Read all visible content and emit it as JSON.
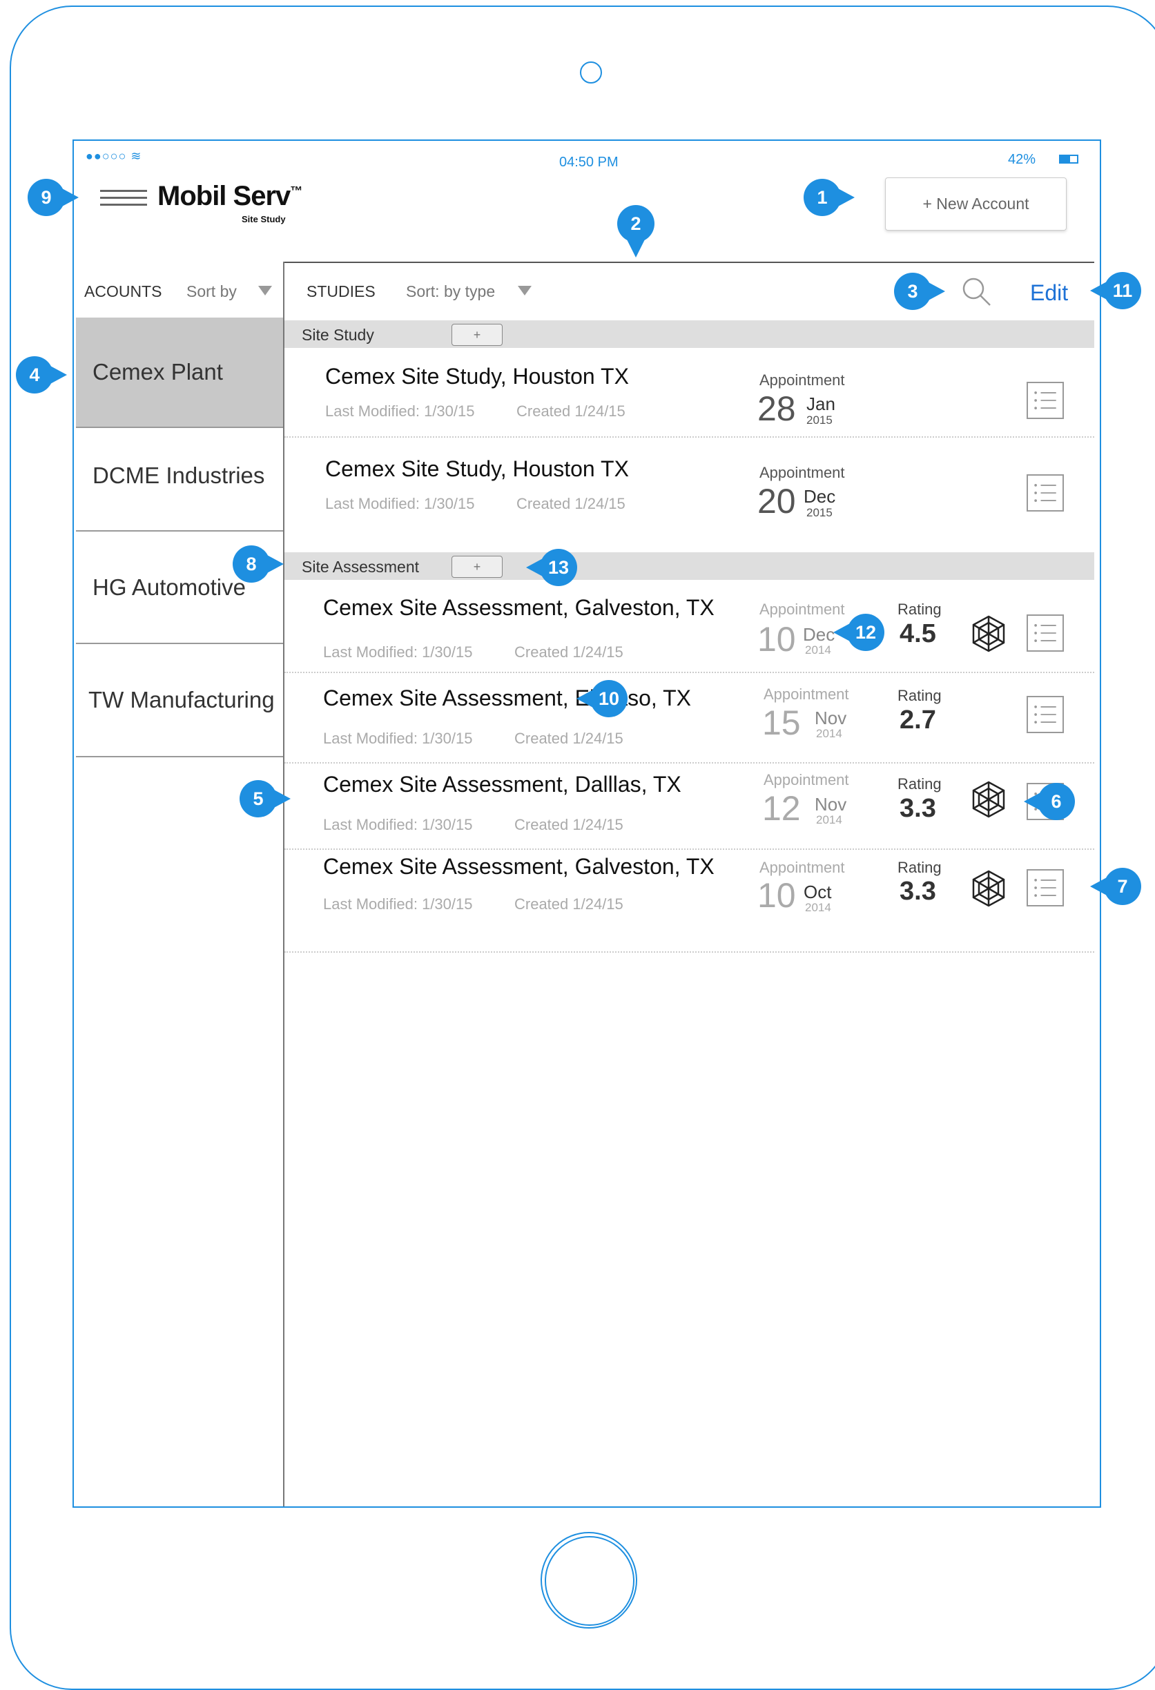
{
  "status_bar": {
    "time": "04:50 PM",
    "battery": "42%"
  },
  "header": {
    "logo": "Mobil Serv",
    "logo_tm": "™",
    "logo_sub": "Site Study",
    "new_account_label": "+   New Account"
  },
  "accounts_pane": {
    "title": "ACOUNTS",
    "sort_label": "Sort by",
    "items": [
      {
        "label": "Cemex Plant",
        "selected": true
      },
      {
        "label": "DCME Industries"
      },
      {
        "label": "HG Automotive"
      },
      {
        "label": "TW Manufacturing"
      }
    ]
  },
  "studies_pane": {
    "title": "STUDIES",
    "sort_label": "Sort: by type",
    "edit_label": "Edit",
    "sections": [
      {
        "label": "Site Study",
        "add_label": "+",
        "rows": [
          {
            "title": "Cemex Site Study, Houston TX",
            "modified": "Last Modified: 1/30/15",
            "created": "Created 1/24/15",
            "appt_label": "Appointment",
            "day": "28",
            "month": "Jan",
            "year": "2015"
          },
          {
            "title": "Cemex Site Study, Houston TX",
            "modified": "Last Modified: 1/30/15",
            "created": "Created 1/24/15",
            "appt_label": "Appointment",
            "day": "20",
            "month": "Dec",
            "year": "2015"
          }
        ]
      },
      {
        "label": "Site Assessment",
        "add_label": "+",
        "rows": [
          {
            "title": "Cemex Site Assessment, Galveston, TX",
            "modified": "Last Modified: 1/30/15",
            "created": "Created 1/24/15",
            "appt_label": "Appointment",
            "day": "10",
            "month": "Dec",
            "year": "2014",
            "rating_label": "Rating",
            "rating": "4.5",
            "radar": true
          },
          {
            "title": "Cemex Site Assessment, El Paso, TX",
            "modified": "Last Modified: 1/30/15",
            "created": "Created 1/24/15",
            "appt_label": "Appointment",
            "day": "15",
            "month": "Nov",
            "year": "2014",
            "rating_label": "Rating",
            "rating": "2.7",
            "radar": false
          },
          {
            "title": "Cemex Site Assessment, Dalllas, TX",
            "modified": "Last Modified: 1/30/15",
            "created": "Created 1/24/15",
            "appt_label": "Appointment",
            "day": "12",
            "month": "Nov",
            "year": "2014",
            "rating_label": "Rating",
            "rating": "3.3",
            "radar": true
          },
          {
            "title": "Cemex Site Assessment, Galveston, TX",
            "modified": "Last Modified: 1/30/15",
            "created": "Created 1/24/15",
            "appt_label": "Appointment",
            "day": "10",
            "month": "Oct",
            "year": "2014",
            "rating_label": "Rating",
            "rating": "3.3",
            "radar": true
          }
        ]
      }
    ]
  },
  "callouts": [
    "1",
    "2",
    "3",
    "4",
    "5",
    "6",
    "7",
    "8",
    "9",
    "10",
    "11",
    "12",
    "13"
  ],
  "colors": {
    "accent": "#1e8fe0",
    "edit_link": "#1e72d6",
    "selected_row": "#c8c8c8",
    "section_bar": "#dedede"
  }
}
